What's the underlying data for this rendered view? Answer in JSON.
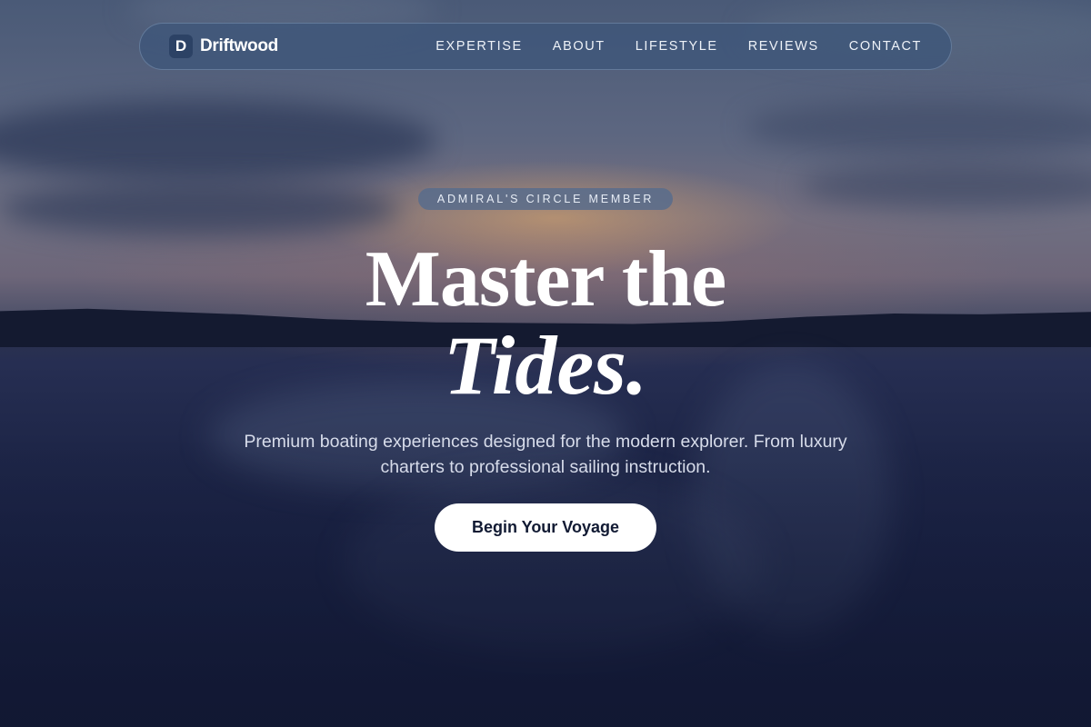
{
  "brand": {
    "mark": "D",
    "name": "Driftwood"
  },
  "nav": {
    "links": [
      "EXPERTISE",
      "ABOUT",
      "LIFESTYLE",
      "REVIEWS",
      "CONTACT"
    ]
  },
  "hero": {
    "badge": "ADMIRAL'S CIRCLE MEMBER",
    "headline_line1": "Master the",
    "headline_line2": "Tides.",
    "subtitle": "Premium boating experiences designed for the modern explorer. From luxury charters to professional sailing instruction.",
    "cta_label": "Begin Your Voyage"
  },
  "colors": {
    "nav_background": "#3e567a",
    "cta_background": "#ffffff",
    "cta_text": "#111a33",
    "page_background": "#141c38"
  }
}
